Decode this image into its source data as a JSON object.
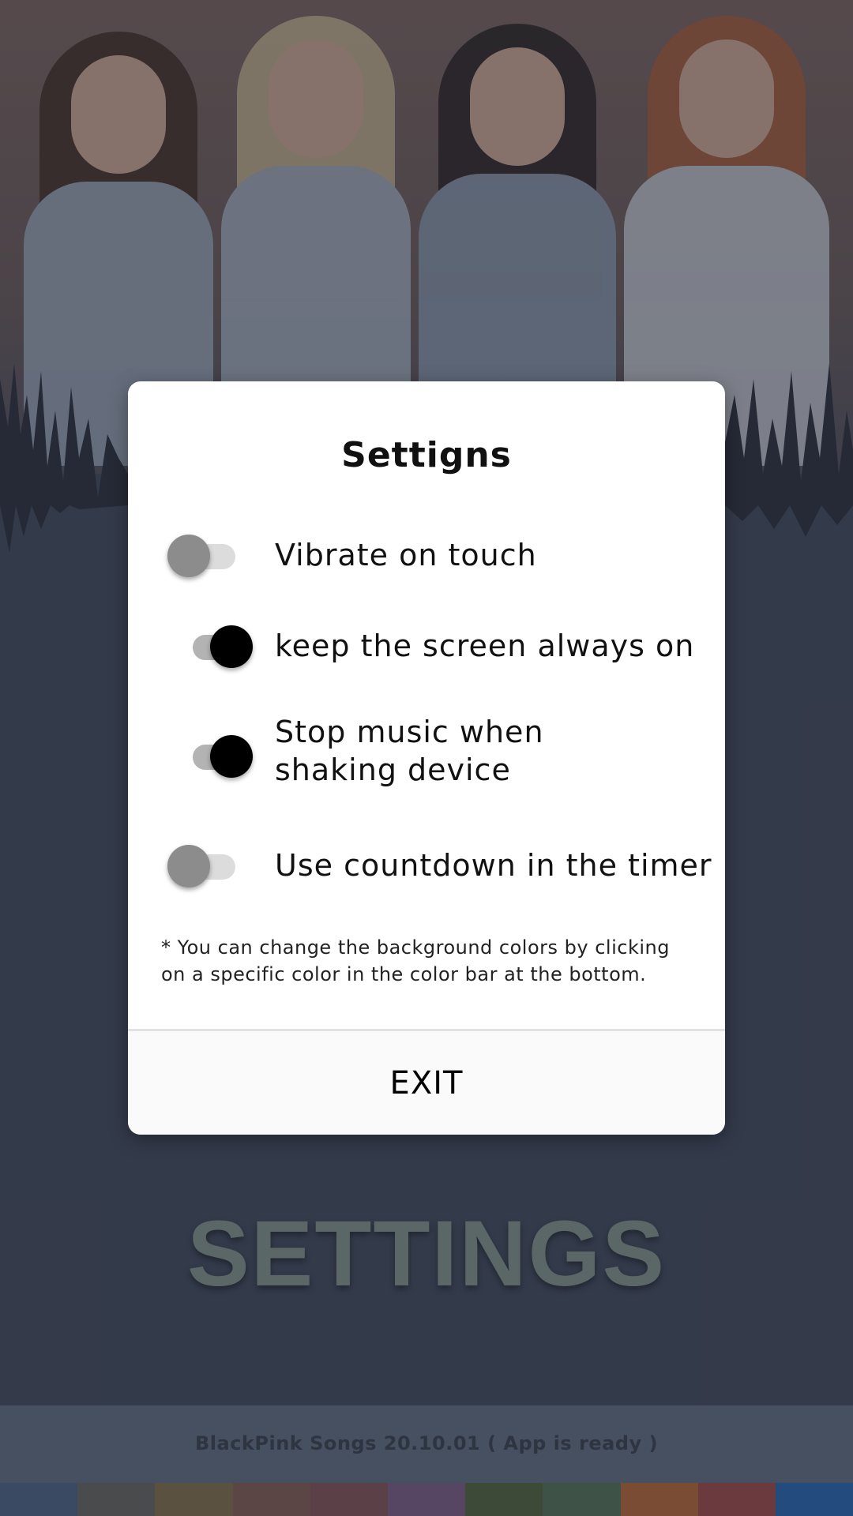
{
  "dialog": {
    "title": "Settigns",
    "settings": [
      {
        "label": "Vibrate on touch",
        "enabled": false
      },
      {
        "label": "keep the screen always on",
        "enabled": true
      },
      {
        "label": "Stop music when shaking device",
        "enabled": true
      },
      {
        "label": "Use countdown in the timer",
        "enabled": false
      }
    ],
    "note": "* You can change the background colors by clicking on a specific color in the color bar at the bottom.",
    "exit_label": "EXIT"
  },
  "page": {
    "heading": "SETTINGS",
    "status": "BlackPink Songs 20.10.01 ( App is ready )"
  },
  "color_bar": [
    "#3b4a63",
    "#494b4d",
    "#5b5140",
    "#5c4645",
    "#5b4048",
    "#564664",
    "#3d4a37",
    "#3f5248",
    "#7a4c34",
    "#6a3a3e",
    "#234b7d"
  ]
}
